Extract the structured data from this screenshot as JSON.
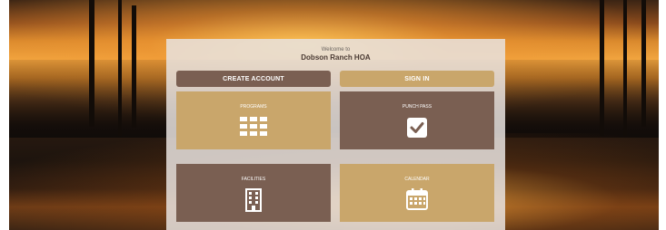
{
  "header": {
    "welcome": "Welcome to",
    "community": "Dobson Ranch HOA"
  },
  "actions": {
    "create_account": "CREATE ACCOUNT",
    "sign_in": "SIGN IN"
  },
  "tiles": [
    {
      "label": "PROGRAMS",
      "icon": "grid-icon",
      "color": "#c9a66b"
    },
    {
      "label": "PUNCH PASS",
      "icon": "checkbox-icon",
      "color": "#7a5f52"
    },
    {
      "label": "FACILITIES",
      "icon": "building-icon",
      "color": "#7a5f52"
    },
    {
      "label": "CALENDAR",
      "icon": "calendar-icon",
      "color": "#c9a66b"
    }
  ],
  "colors": {
    "brown": "#7a5f52",
    "tan": "#c9a66b",
    "panel": "#e8e2de"
  }
}
